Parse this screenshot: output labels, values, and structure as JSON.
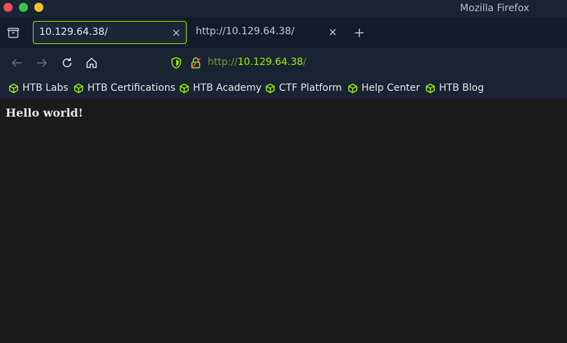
{
  "window": {
    "title": "Mozilla Firefox",
    "traffic_lights": [
      "close",
      "maximize",
      "minimize"
    ]
  },
  "tabs": [
    {
      "title": "10.129.64.38/",
      "active": true
    },
    {
      "title": "http://10.129.64.38/",
      "active": false
    }
  ],
  "navbar": {
    "url_scheme": "http://",
    "url_host": "10.129.64.38",
    "url_path": "/",
    "icons": [
      "back-icon",
      "forward-icon",
      "reload-icon",
      "home-icon",
      "shield-icon",
      "insecure-lock-icon"
    ]
  },
  "bookmarks": [
    {
      "label": "HTB Labs"
    },
    {
      "label": "HTB Certifications"
    },
    {
      "label": "HTB Academy"
    },
    {
      "label": "CTF Platform"
    },
    {
      "label": "Help Center"
    },
    {
      "label": "HTB Blog"
    }
  ],
  "page": {
    "heading": "Hello world!"
  },
  "colors": {
    "accent": "#9fef00",
    "chrome": "#1a2332",
    "tabstrip": "#131c2b",
    "content_bg": "#1c1b1c"
  }
}
